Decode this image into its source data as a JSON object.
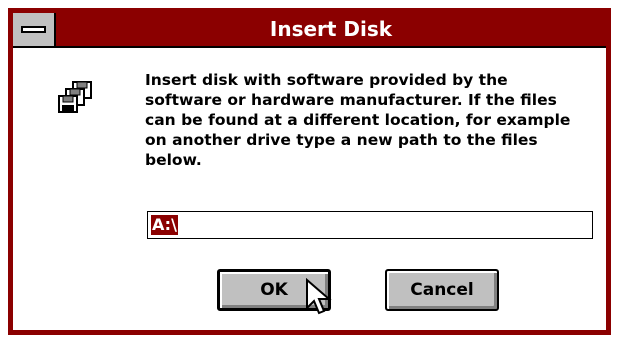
{
  "dialog": {
    "title": "Insert Disk",
    "message": "Insert disk with software provided by the\nsoftware or hardware manufacturer.  If the files\ncan be found at a different location, for example\non another drive type a new path to the files\nbelow.",
    "path_value": "A:\\",
    "ok_label": "OK",
    "cancel_label": "Cancel"
  },
  "icons": {
    "system_menu": "system-menu-icon",
    "disk": "disk-icon",
    "cursor": "mouse-pointer-icon"
  },
  "colors": {
    "title_bar": "#8b0000",
    "frame": "#8b0000",
    "selection": "#8b0000",
    "button_face": "#c0c0c0"
  }
}
